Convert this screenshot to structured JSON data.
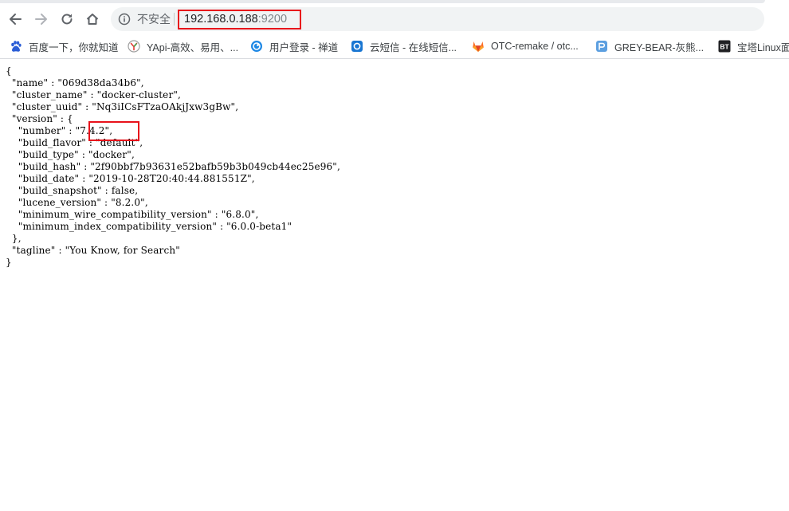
{
  "toolbar": {
    "security_label": "不安全",
    "url_host": "192.168.0.188",
    "url_port": ":9200"
  },
  "bookmarks": [
    {
      "label": "百度一下，你就知道",
      "icon": "baidu-paw-icon"
    },
    {
      "label": "YApi-高效、易用、...",
      "icon": "yapi-icon"
    },
    {
      "label": "用户登录 - 禅道",
      "icon": "zentao-icon"
    },
    {
      "label": "云短信 - 在线短信...",
      "icon": "cloud-sms-icon"
    },
    {
      "label": "OTC-remake / otc...",
      "icon": "gitlab-fox-icon"
    },
    {
      "label": "GREY-BEAR-灰熊...",
      "icon": "greybear-icon"
    },
    {
      "label": "宝塔Linux面",
      "icon": "bt-icon"
    }
  ],
  "json_response": {
    "open": "{",
    "name": "  \"name\" : \"069d38da34b6\",",
    "cluster_name": "  \"cluster_name\" : \"docker-cluster\",",
    "cluster_uuid": "  \"cluster_uuid\" : \"Nq3iICsFTzaOAkjJxw3gBw\",",
    "version_open": "  \"version\" : {",
    "number": "    \"number\" : \"7.4.2\",",
    "build_flavor": "    \"build_flavor\" : \"default\",",
    "build_type": "    \"build_type\" : \"docker\",",
    "build_hash": "    \"build_hash\" : \"2f90bbf7b93631e52bafb59b3b049cb44ec25e96\",",
    "build_date": "    \"build_date\" : \"2019-10-28T20:40:44.881551Z\",",
    "build_snapshot": "    \"build_snapshot\" : false,",
    "lucene_version": "    \"lucene_version\" : \"8.2.0\",",
    "minimum_wire_compatibility_version": "    \"minimum_wire_compatibility_version\" : \"6.8.0\",",
    "minimum_index_compatibility_version": "    \"minimum_index_compatibility_version\" : \"6.0.0-beta1\"",
    "version_close": "  },",
    "tagline": "  \"tagline\" : \"You Know, for Search\"",
    "close": "}"
  },
  "colors": {
    "annotation_red": "#e8121b",
    "toolbar_icon": "#5f6368",
    "omnibox_bg": "#f1f3f4"
  }
}
